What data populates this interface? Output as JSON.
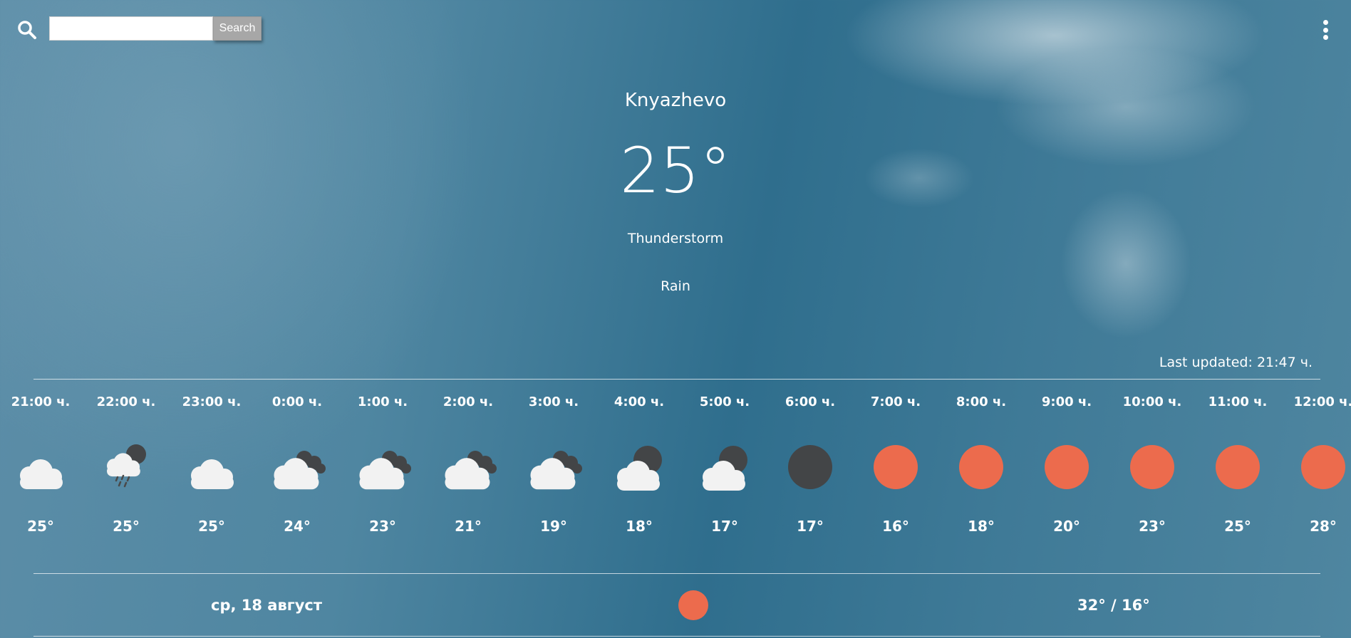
{
  "search": {
    "placeholder": "",
    "value": "",
    "button_label": "Search"
  },
  "current": {
    "city": "Knyazhevo",
    "temperature": "25°",
    "condition": "Thunderstorm",
    "precipitation": "Rain",
    "last_updated": "Last updated: 21:47 ч."
  },
  "colors": {
    "sun": "#ec6b4d",
    "moon": "#434547",
    "cloud": "#f2f2f2",
    "rain": "#4a4a4a"
  },
  "hourly": [
    {
      "time": "21:00 ч.",
      "icon": "cloud-icon",
      "temp": "25°"
    },
    {
      "time": "22:00 ч.",
      "icon": "cloud-moon-rain-icon",
      "temp": "25°"
    },
    {
      "time": "23:00 ч.",
      "icon": "cloud-icon",
      "temp": "25°"
    },
    {
      "time": "0:00 ч.",
      "icon": "cloud-dark-clouds-icon",
      "temp": "24°"
    },
    {
      "time": "1:00 ч.",
      "icon": "cloud-dark-clouds-icon",
      "temp": "23°"
    },
    {
      "time": "2:00 ч.",
      "icon": "cloud-dark-clouds-icon",
      "temp": "21°"
    },
    {
      "time": "3:00 ч.",
      "icon": "cloud-dark-clouds-icon",
      "temp": "19°"
    },
    {
      "time": "4:00 ч.",
      "icon": "cloud-moon-icon",
      "temp": "18°"
    },
    {
      "time": "5:00 ч.",
      "icon": "cloud-moon-icon",
      "temp": "17°"
    },
    {
      "time": "6:00 ч.",
      "icon": "moon-icon",
      "temp": "17°"
    },
    {
      "time": "7:00 ч.",
      "icon": "sun-icon",
      "temp": "16°"
    },
    {
      "time": "8:00 ч.",
      "icon": "sun-icon",
      "temp": "18°"
    },
    {
      "time": "9:00 ч.",
      "icon": "sun-icon",
      "temp": "20°"
    },
    {
      "time": "10:00 ч.",
      "icon": "sun-icon",
      "temp": "23°"
    },
    {
      "time": "11:00 ч.",
      "icon": "sun-icon",
      "temp": "25°"
    },
    {
      "time": "12:00 ч.",
      "icon": "sun-icon",
      "temp": "28°"
    }
  ],
  "daily": [
    {
      "date": "ср, 18 август",
      "icon": "sun-icon",
      "range": "32° / 16°"
    }
  ]
}
